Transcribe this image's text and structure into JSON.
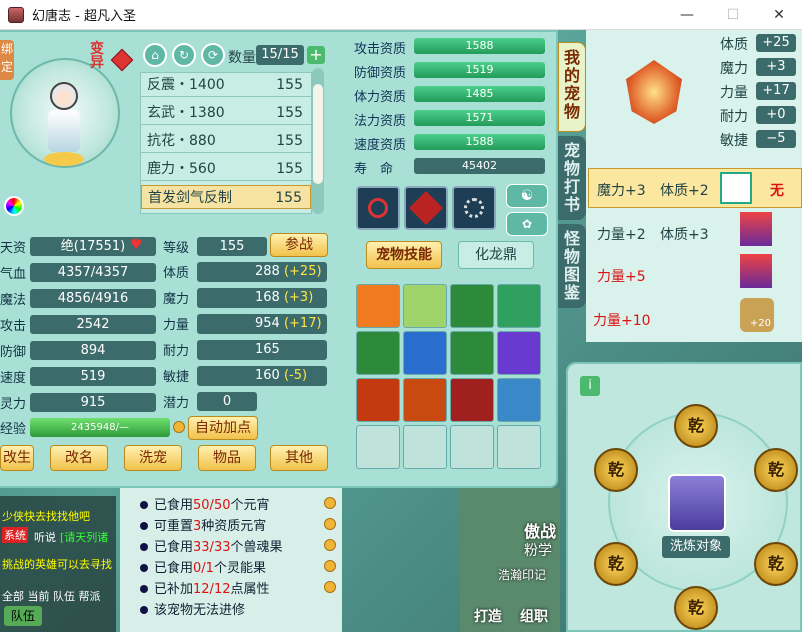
{
  "window": {
    "title": "幻唐志 - 超凡入圣",
    "minimize": "—",
    "maximize": "☐",
    "close": "✕"
  },
  "portrait": {
    "side_label": "绑定",
    "transform_label": "变异"
  },
  "qty": {
    "label": "数量",
    "value": "15/15",
    "add": "+"
  },
  "skills": [
    {
      "name": "反震・1400",
      "value": "155"
    },
    {
      "name": "玄武・1380",
      "value": "155"
    },
    {
      "name": "抗花・880",
      "value": "155"
    },
    {
      "name": "鹿力・560",
      "value": "155"
    },
    {
      "name": "首发剑气反制",
      "value": "155"
    }
  ],
  "stats": {
    "zizhi": {
      "label": "天资",
      "value": "绝(17551)"
    },
    "qixue": {
      "label": "气血",
      "value": "4357/4357"
    },
    "mofa": {
      "label": "魔法",
      "value": "4856/4916"
    },
    "gongji": {
      "label": "攻击",
      "value": "2542"
    },
    "fangyu": {
      "label": "防御",
      "value": "894"
    },
    "sudu": {
      "label": "速度",
      "value": "519"
    },
    "lingli": {
      "label": "灵力",
      "value": "915"
    },
    "jingyan": {
      "label": "经验",
      "value": "2435948/—"
    }
  },
  "attrs": {
    "dengji": {
      "label": "等级",
      "value": "155"
    },
    "tizhi": {
      "label": "体质",
      "value": "288",
      "bonus": "(+25)"
    },
    "moli": {
      "label": "魔力",
      "value": "168",
      "bonus": "(+3)"
    },
    "liliang": {
      "label": "力量",
      "value": "954",
      "bonus": "(+17)"
    },
    "naili": {
      "label": "耐力",
      "value": "165",
      "bonus": ""
    },
    "minjie": {
      "label": "敏捷",
      "value": "160",
      "bonus": "(-5)"
    },
    "qianli": {
      "label": "潜力",
      "value": "0"
    }
  },
  "buttons": {
    "canzhan": "参战",
    "auto_add": "自动加点",
    "gaisheng": "改生",
    "gaiming": "改名",
    "xichong": "洗宠",
    "wupin": "物品",
    "qita": "其他",
    "pet_skill": "宠物技能",
    "hualongding": "化龙鼎",
    "xilian": "洗炼对象"
  },
  "quality": [
    {
      "label": "攻击资质",
      "value": "1588"
    },
    {
      "label": "防御资质",
      "value": "1519"
    },
    {
      "label": "体力资质",
      "value": "1485"
    },
    {
      "label": "法力资质",
      "value": "1571"
    },
    {
      "label": "速度资质",
      "value": "1588"
    },
    {
      "label": "寿　命",
      "value": "45402"
    }
  ],
  "tabs": {
    "my_pet": "我的宠物",
    "pet_book": "宠物打书",
    "monster_guide": "怪物图鉴"
  },
  "right_stats": [
    {
      "label": "体质",
      "value": "+25"
    },
    {
      "label": "魔力",
      "value": "+3"
    },
    {
      "label": "力量",
      "value": "+17"
    },
    {
      "label": "耐力",
      "value": "+0"
    },
    {
      "label": "敏捷",
      "value": "−5"
    }
  ],
  "options": [
    {
      "a": "魔力+3",
      "b": "体质+2",
      "tag": "无"
    },
    {
      "a": "力量+2",
      "b": "体质+3",
      "tag": ""
    },
    {
      "a": "力量+5",
      "b": "",
      "tag": ""
    },
    {
      "a": "力量+10",
      "b": "",
      "tag": "+20"
    }
  ],
  "info": [
    {
      "pre": "已食用",
      "red": "50/50",
      "post": "个元宵"
    },
    {
      "pre": "可重置",
      "red": "3",
      "post": "种资质元宵"
    },
    {
      "pre": "已食用",
      "red": "33/33",
      "post": "个兽魂果"
    },
    {
      "pre": "已食用",
      "red": "0/1",
      "post": "个灵能果"
    },
    {
      "pre": "已补加",
      "red": "12/12",
      "post": "点属性"
    },
    {
      "pre": "该宠物无法进修",
      "red": "",
      "post": ""
    }
  ],
  "chat": {
    "line1": "少侠快去找找他吧",
    "sys": "系统",
    "line2a": "听说",
    "line2b": "[请天列诸",
    "line3": "挑战的英雄可以去寻找",
    "tabs": "全部 当前 队伍 帮派",
    "team": "队伍"
  },
  "qian_label": "乾",
  "bottom_bar": {
    "daxing": "打造",
    "zuzhi": "组职"
  },
  "scene_text": {
    "a": "傲战",
    "b": "粉学",
    "c": "浩瀚印记"
  }
}
